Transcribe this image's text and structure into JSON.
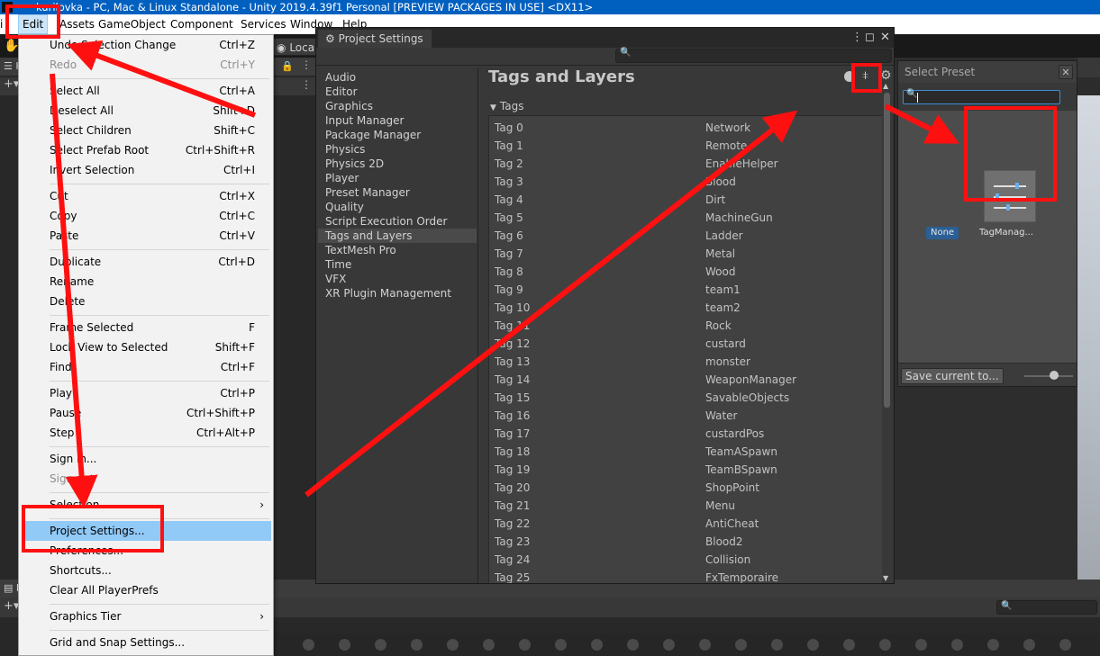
{
  "window": {
    "title": "kurilovka - PC, Mac & Linux Standalone - Unity 2019.4.39f1 Personal [PREVIEW PACKAGES IN USE] <DX11>"
  },
  "menubar": {
    "items": [
      "Edit",
      "Assets",
      "GameObject",
      "Component",
      "Services",
      "Window",
      "Help"
    ],
    "active": "Edit"
  },
  "toolbar": {
    "local_label": "Local"
  },
  "edit_menu": {
    "items": [
      {
        "label": "Undo Selection Change",
        "shortcut": "Ctrl+Z"
      },
      {
        "label": "Redo",
        "shortcut": "Ctrl+Y",
        "disabled": true
      },
      {
        "label": "Select All",
        "shortcut": "Ctrl+A"
      },
      {
        "label": "Deselect All",
        "shortcut": "Shift+D"
      },
      {
        "label": "Select Children",
        "shortcut": "Shift+C"
      },
      {
        "label": "Select Prefab Root",
        "shortcut": "Ctrl+Shift+R"
      },
      {
        "label": "Invert Selection",
        "shortcut": "Ctrl+I"
      },
      {
        "label": "Cut",
        "shortcut": "Ctrl+X"
      },
      {
        "label": "Copy",
        "shortcut": "Ctrl+C"
      },
      {
        "label": "Paste",
        "shortcut": "Ctrl+V"
      },
      {
        "label": "Duplicate",
        "shortcut": "Ctrl+D"
      },
      {
        "label": "Rename",
        "shortcut": ""
      },
      {
        "label": "Delete",
        "shortcut": ""
      },
      {
        "label": "Frame Selected",
        "shortcut": "F"
      },
      {
        "label": "Lock View to Selected",
        "shortcut": "Shift+F"
      },
      {
        "label": "Find",
        "shortcut": "Ctrl+F"
      },
      {
        "label": "Play",
        "shortcut": "Ctrl+P"
      },
      {
        "label": "Pause",
        "shortcut": "Ctrl+Shift+P"
      },
      {
        "label": "Step",
        "shortcut": "Ctrl+Alt+P"
      },
      {
        "label": "Sign in...",
        "shortcut": ""
      },
      {
        "label": "Sign out",
        "shortcut": "",
        "disabled": true
      },
      {
        "label": "Selection",
        "submenu": true
      },
      {
        "label": "Project Settings...",
        "selected": true
      },
      {
        "label": "Preferences...",
        "shortcut": ""
      },
      {
        "label": "Shortcuts...",
        "shortcut": ""
      },
      {
        "label": "Clear All PlayerPrefs",
        "shortcut": ""
      },
      {
        "label": "Graphics Tier",
        "submenu": true
      },
      {
        "label": "Grid and Snap Settings...",
        "shortcut": ""
      }
    ]
  },
  "project_settings": {
    "tab_label": "Project Settings",
    "categories": [
      "Audio",
      "Editor",
      "Graphics",
      "Input Manager",
      "Package Manager",
      "Physics",
      "Physics 2D",
      "Player",
      "Preset Manager",
      "Quality",
      "Script Execution Order",
      "Tags and Layers",
      "TextMesh Pro",
      "Time",
      "VFX",
      "XR Plugin Management"
    ],
    "active_category": "Tags and Layers",
    "title": "Tags and Layers",
    "tags_header": "Tags",
    "tags": [
      {
        "name": "Tag 0",
        "value": "Network"
      },
      {
        "name": "Tag 1",
        "value": "Remote"
      },
      {
        "name": "Tag 2",
        "value": "EnableHelper"
      },
      {
        "name": "Tag 3",
        "value": "Blood"
      },
      {
        "name": "Tag 4",
        "value": "Dirt"
      },
      {
        "name": "Tag 5",
        "value": "MachineGun"
      },
      {
        "name": "Tag 6",
        "value": "Ladder"
      },
      {
        "name": "Tag 7",
        "value": "Metal"
      },
      {
        "name": "Tag 8",
        "value": "Wood"
      },
      {
        "name": "Tag 9",
        "value": "team1"
      },
      {
        "name": "Tag 10",
        "value": "team2"
      },
      {
        "name": "Tag 11",
        "value": "Rock"
      },
      {
        "name": "Tag 12",
        "value": "custard"
      },
      {
        "name": "Tag 13",
        "value": "monster"
      },
      {
        "name": "Tag 14",
        "value": "WeaponManager"
      },
      {
        "name": "Tag 15",
        "value": "SavableObjects"
      },
      {
        "name": "Tag 16",
        "value": "Water"
      },
      {
        "name": "Tag 17",
        "value": "custardPos"
      },
      {
        "name": "Tag 18",
        "value": "TeamASpawn"
      },
      {
        "name": "Tag 19",
        "value": "TeamBSpawn"
      },
      {
        "name": "Tag 20",
        "value": "ShopPoint"
      },
      {
        "name": "Tag 21",
        "value": "Menu"
      },
      {
        "name": "Tag 22",
        "value": "AntiCheat"
      },
      {
        "name": "Tag 23",
        "value": "Blood2"
      },
      {
        "name": "Tag 24",
        "value": "Collision"
      },
      {
        "name": "Tag 25",
        "value": "FxTemporaire"
      }
    ]
  },
  "select_preset": {
    "title": "Select Preset",
    "none_label": "None",
    "item_label": "TagManag...",
    "save_button": "Save current to..."
  },
  "colors": {
    "annotation_red": "#ff1010",
    "menu_selection": "#91c9f7",
    "unity_dark": "#383838"
  }
}
